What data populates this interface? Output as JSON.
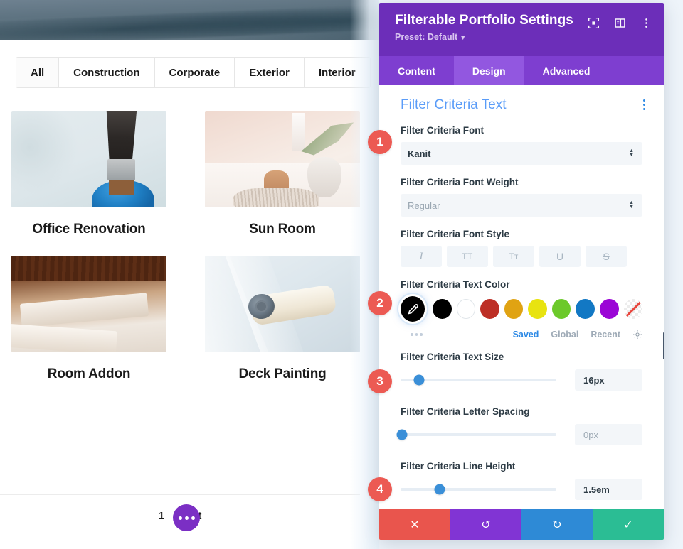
{
  "website": {
    "filters": [
      {
        "label": "All",
        "active": true
      },
      {
        "label": "Construction",
        "active": false
      },
      {
        "label": "Corporate",
        "active": false
      },
      {
        "label": "Exterior",
        "active": false
      },
      {
        "label": "Interior",
        "active": false
      }
    ],
    "portfolio": [
      {
        "title": "Office Renovation",
        "image": "paint-brush-photo"
      },
      {
        "title": "Sun Room",
        "image": "sun-room-vase-photo"
      },
      {
        "title": "Room Addon",
        "image": "wood-planks-photo"
      },
      {
        "title": "Deck Painting",
        "image": "paint-roller-photo"
      }
    ],
    "pagination": {
      "current_page": "1",
      "next_label": "Next",
      "overflow_icon": "ellipsis-icon"
    }
  },
  "panel": {
    "title": "Filterable Portfolio Settings",
    "preset": "Preset: Default",
    "header_icons": [
      "focus-frame-icon",
      "panel-layout-icon",
      "vertical-ellipsis-icon"
    ],
    "tabs": [
      {
        "label": "Content",
        "active": false
      },
      {
        "label": "Design",
        "active": true
      },
      {
        "label": "Advanced",
        "active": false
      }
    ],
    "section": {
      "title": "Filter Criteria Text",
      "menu_icon": "vertical-ellipsis-icon"
    },
    "fields": {
      "font": {
        "label": "Filter Criteria Font",
        "value": "Kanit"
      },
      "font_weight": {
        "label": "Filter Criteria Font Weight",
        "value": "Regular"
      },
      "font_style": {
        "label": "Filter Criteria Font Style",
        "buttons": [
          {
            "name": "italic",
            "glyph": "I"
          },
          {
            "name": "uppercase",
            "glyph": "TT"
          },
          {
            "name": "capitalize",
            "glyph": "Tᴛ"
          },
          {
            "name": "underline",
            "glyph": "U"
          },
          {
            "name": "strikethrough",
            "glyph": "S"
          }
        ]
      },
      "text_color": {
        "label": "Filter Criteria Text Color",
        "picker_icon": "eyedropper-icon",
        "swatches": [
          "#000000",
          "#ffffff",
          "#bd2f26",
          "#e0a313",
          "#e8e310",
          "#6cc92a",
          "#1278c4",
          "#9b06d6",
          "transparent"
        ],
        "more_icon": "more-dots-icon",
        "tabs": [
          {
            "label": "Saved",
            "active": true
          },
          {
            "label": "Global",
            "active": false
          },
          {
            "label": "Recent",
            "active": false
          }
        ],
        "settings_icon": "gear-icon"
      },
      "text_size": {
        "label": "Filter Criteria Text Size",
        "value": "16px",
        "slider_percent": 12
      },
      "letter_spacing": {
        "label": "Filter Criteria Letter Spacing",
        "value": "0px",
        "slider_percent": 0
      },
      "line_height": {
        "label": "Filter Criteria Line Height",
        "value": "1.5em",
        "slider_percent": 25
      }
    },
    "footer": [
      {
        "name": "cancel",
        "glyph": "✕"
      },
      {
        "name": "undo",
        "glyph": "↺"
      },
      {
        "name": "redo",
        "glyph": "↻"
      },
      {
        "name": "save",
        "glyph": "✓"
      }
    ]
  },
  "annotations": [
    {
      "number": "1"
    },
    {
      "number": "2"
    },
    {
      "number": "3"
    },
    {
      "number": "4"
    }
  ],
  "colors": {
    "panel_header": "#6c2eb9",
    "tab_active": "#9257e0",
    "section_title": "#5a9cf8",
    "badge": "#ec5a53",
    "slider": "#3a8fd8"
  }
}
